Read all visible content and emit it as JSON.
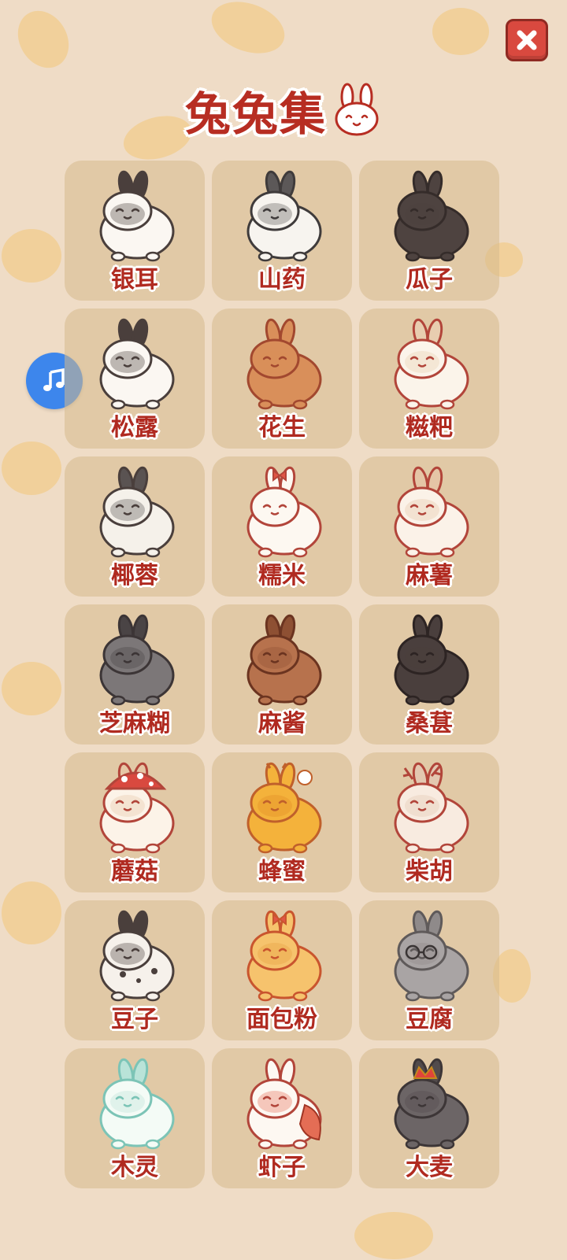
{
  "title": "兔兔集",
  "icons": {
    "close": "close-icon",
    "music": "music-note-icon",
    "title_bunny": "bunny-face-icon"
  },
  "colors": {
    "accent": "#b72d22",
    "close": "#d9493f",
    "music": "#3d86ec",
    "card": "#d6b98c"
  },
  "rabbits": [
    {
      "name": "银耳",
      "body": "#fbf7f2",
      "patch": "#4a3f3c",
      "ears": "#4a3f3c",
      "outline": "#4a3f3c",
      "accessory": ""
    },
    {
      "name": "山药",
      "body": "#f7f4ef",
      "patch": "#5c5858",
      "ears": "#5c5858",
      "outline": "#3f3b3b",
      "accessory": ""
    },
    {
      "name": "瓜子",
      "body": "#4e4340",
      "patch": "#4e4340",
      "ears": "#4e4340",
      "outline": "#352c2a",
      "accessory": ""
    },
    {
      "name": "松露",
      "body": "#fbf7f2",
      "patch": "#4a3f3c",
      "ears": "#4a3f3c",
      "outline": "#4a3f3c",
      "accessory": ""
    },
    {
      "name": "花生",
      "body": "#d98f5a",
      "patch": "#d98f5a",
      "ears": "#d98f5a",
      "outline": "#a2482f",
      "accessory": ""
    },
    {
      "name": "糍粑",
      "body": "#fbf4ea",
      "patch": "#e8cdb0",
      "ears": "#e8cdb0",
      "outline": "#b2453a",
      "accessory": ""
    },
    {
      "name": "椰蓉",
      "body": "#f5f1ea",
      "patch": "#5a5352",
      "ears": "#5a5352",
      "outline": "#4a3f3c",
      "accessory": ""
    },
    {
      "name": "糯米",
      "body": "#fdf8f1",
      "patch": "#fdf8f1",
      "ears": "#fdf8f1",
      "outline": "#b2453a",
      "accessory": "bow"
    },
    {
      "name": "麻薯",
      "body": "#fbf2e8",
      "patch": "#e5c5a6",
      "ears": "#e5c5a6",
      "outline": "#b2453a",
      "accessory": ""
    },
    {
      "name": "芝麻糊",
      "body": "#7c7778",
      "patch": "#4a4445",
      "ears": "#4a4445",
      "outline": "#3c3536",
      "accessory": ""
    },
    {
      "name": "麻酱",
      "body": "#b7724d",
      "patch": "#8e5033",
      "ears": "#8e5033",
      "outline": "#6b3420",
      "accessory": ""
    },
    {
      "name": "桑葚",
      "body": "#4a3f3d",
      "patch": "#4a3f3d",
      "ears": "#4a3f3d",
      "outline": "#2d2423",
      "accessory": ""
    },
    {
      "name": "蘑菇",
      "body": "#fcf3e8",
      "patch": "#e6c6a5",
      "ears": "#e6c6a5",
      "outline": "#b2453a",
      "accessory": "mushroom"
    },
    {
      "name": "蜂蜜",
      "body": "#f4b23b",
      "patch": "#e08a24",
      "ears": "#f4b23b",
      "outline": "#c0602b",
      "accessory": "bee"
    },
    {
      "name": "柴胡",
      "body": "#f8ebe0",
      "patch": "#e3c7b0",
      "ears": "#e3c7b0",
      "outline": "#b2453a",
      "accessory": "antler"
    },
    {
      "name": "豆子",
      "body": "#f6f1eb",
      "patch": "#4a3f3c",
      "ears": "#4a3f3c",
      "outline": "#4a3f3c",
      "accessory": "spots"
    },
    {
      "name": "面包粉",
      "body": "#f6c36d",
      "patch": "#e59e3f",
      "ears": "#f6c36d",
      "outline": "#c9552e",
      "accessory": "bow"
    },
    {
      "name": "豆腐",
      "body": "#a9a4a4",
      "patch": "#8f8a8a",
      "ears": "#8f8a8a",
      "outline": "#5f5a5a",
      "accessory": "glasses"
    },
    {
      "name": "木灵",
      "body": "#f4fbf6",
      "patch": "#b9e3d8",
      "ears": "#b9e3d8",
      "outline": "#7cc4b6",
      "accessory": ""
    },
    {
      "name": "虾子",
      "body": "#fdf8f2",
      "patch": "#e46d55",
      "ears": "#fdf8f2",
      "outline": "#b2453a",
      "accessory": "shrimp"
    },
    {
      "name": "大麦",
      "body": "#6c6566",
      "patch": "#524b4c",
      "ears": "#524b4c",
      "outline": "#3d3637",
      "accessory": "crown"
    }
  ]
}
